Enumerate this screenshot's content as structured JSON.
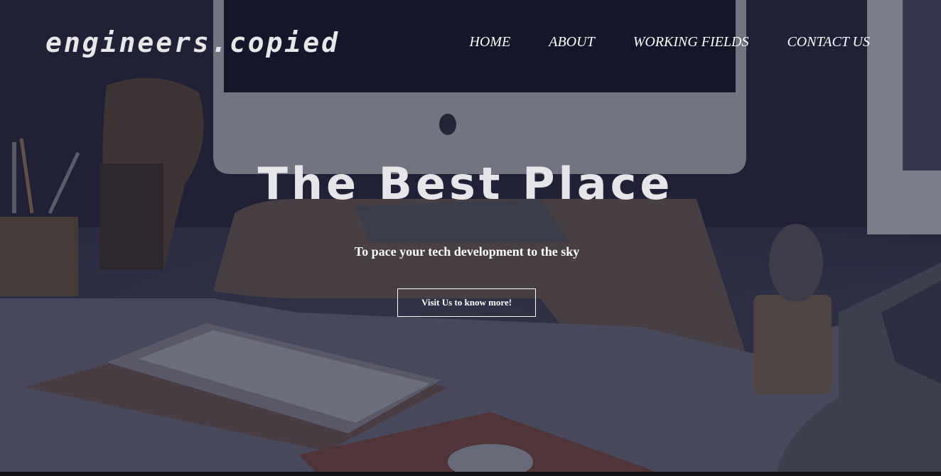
{
  "header": {
    "logo": "engineers.copied",
    "nav": [
      {
        "label": "HOME"
      },
      {
        "label": "ABOUT"
      },
      {
        "label": "WORKING FIELDS"
      },
      {
        "label": "CONTACT US"
      }
    ]
  },
  "hero": {
    "title": "The Best Place",
    "subtitle": "To pace your tech development to the sky",
    "cta_label": "Visit Us to know more!"
  },
  "colors": {
    "overlay": "#1c1e33",
    "text": "#ffffff",
    "logo_text": "#e8e8ea"
  }
}
